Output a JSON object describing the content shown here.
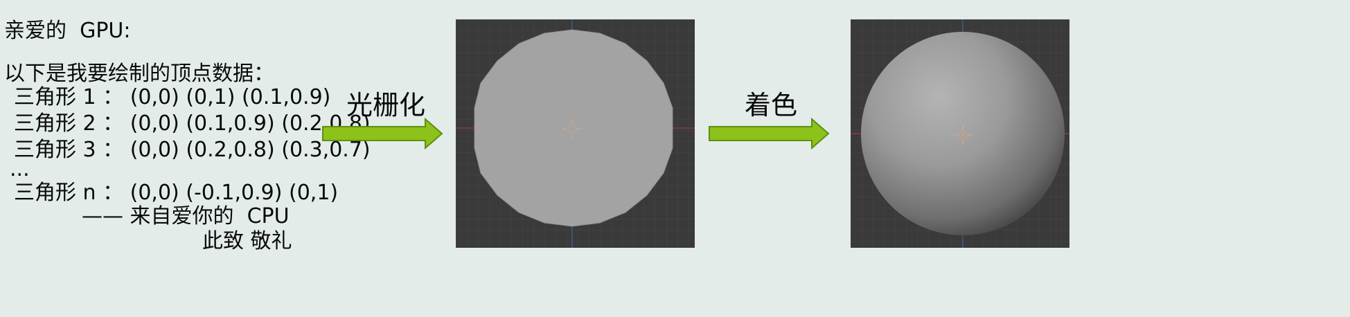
{
  "letter": {
    "greeting": "亲爱的  GPU:",
    "intro": "以下是我要绘制的顶点数据：",
    "triangles": [
      {
        "label": "三角形 1 ： (0,0) (0,1) (0.1,0.9)"
      },
      {
        "label": "三角形 2 ： (0,0) (0.1,0.9) (0.2,0.8)"
      },
      {
        "label": "三角形 3 ： (0,0) (0.2,0.8) (0.3,0.7)"
      }
    ],
    "ellipsis": "...",
    "last_triangle": "三角形 n ： (0,0) (-0.1,0.9) (0,1)",
    "signature": "—— 来自爱你的  CPU",
    "closing": "此致 敬礼"
  },
  "steps": [
    {
      "label": "光栅化"
    },
    {
      "label": "着色"
    }
  ],
  "colors": {
    "background": "#e3ece9",
    "arrow_fill": "#8cc21a",
    "arrow_stroke": "#5e8f10",
    "viewport_bg": "#3a3a3a",
    "flat_disc": "#a3a3a3"
  }
}
